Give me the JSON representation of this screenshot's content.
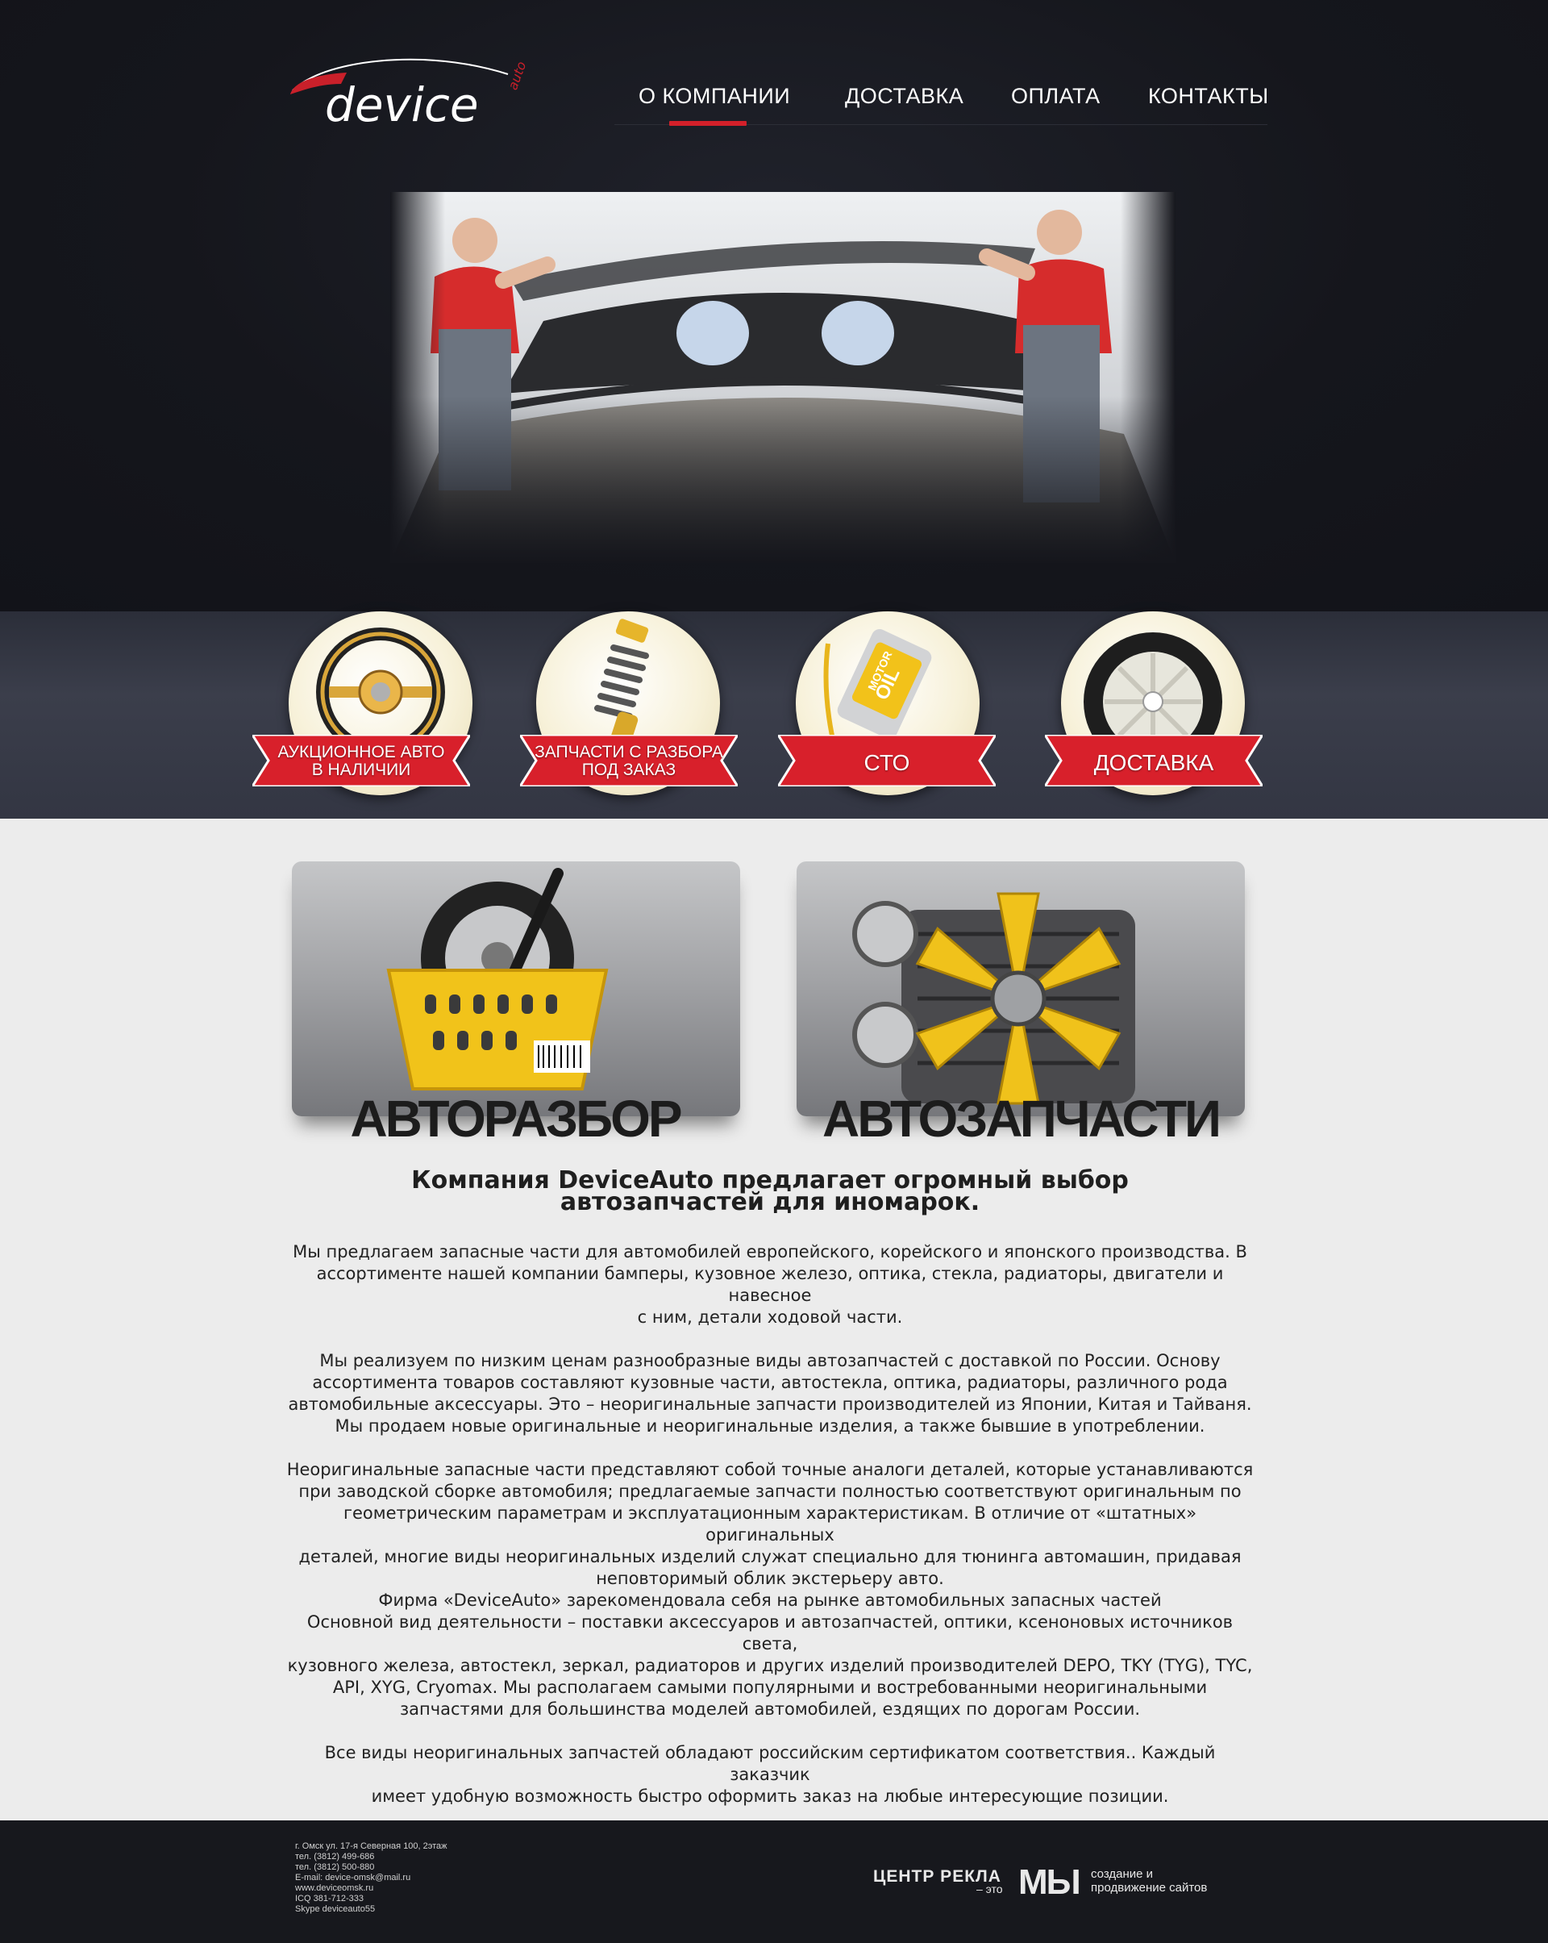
{
  "header": {
    "logo_text": "device",
    "logo_mark": "auto",
    "nav": [
      {
        "label": "О КОМПАНИИ",
        "active": true
      },
      {
        "label": "ДОСТАВКА"
      },
      {
        "label": "ОПЛАТА"
      },
      {
        "label": "КОНТАКТЫ"
      }
    ]
  },
  "hero": {
    "image": "mechanics-installing-windshield-photo"
  },
  "categories": [
    {
      "line1": "АУКЦИОННОЕ АВТО",
      "line2": "В НАЛИЧИИ",
      "icon": "steering-wheel-icon"
    },
    {
      "line1": "ЗАПЧАСТИ С РАЗБОРА",
      "line2": "ПОД ЗАКАЗ",
      "icon": "shock-absorber-icon"
    },
    {
      "line1": "СТО",
      "icon": "motor-oil-icon"
    },
    {
      "line1": "ДОСТАВКА",
      "icon": "wheel-icon"
    }
  ],
  "tiles": [
    {
      "title": "АВТОРАЗБОР",
      "icon": "basket-with-wheel-icon"
    },
    {
      "title": "АВТОЗАПЧАСТИ",
      "icon": "engine-fan-icon"
    }
  ],
  "oil_label": {
    "top": "MOTOR",
    "bottom": "OIL"
  },
  "content": {
    "headline_1": "Компания DeviceAuto предлагает огромный выбор",
    "headline_2": "автозапчастей для иномарок.",
    "p1": "Мы предлагаем запасные части для автомобилей европейского, корейского и японского производства. В\nассортименте нашей компании бамперы, кузовное железо, оптика, стекла, радиаторы, двигатели и навесное\nс ним, детали ходовой части.",
    "p2": "Мы реализуем по низким ценам разнообразные виды автозапчастей с доставкой по России. Основу\nассортимента товаров составляют кузовные части, автостекла, оптика, радиаторы, различного рода\nавтомобильные аксессуары. Это – неоригинальные запчасти производителей из Японии, Китая и Тайваня.\nМы продаем новые оригинальные и неоригинальные изделия, а также бывшие в употреблении.",
    "p3": "Неоригинальные запасные части представляют собой точные аналоги деталей, которые устанавливаются\nпри заводской сборке автомобиля; предлагаемые запчасти полностью соответствуют оригинальным по\nгеометрическим параметрам и эксплуатационным характеристикам. В отличие от «штатных» оригинальных\nдеталей, многие виды неоригинальных изделий служат специально для тюнинга автомашин, придавая\nнеповторимый облик экстерьеру авто.",
    "p4": "Фирма «DeviceAuto» зарекомендовала себя на рынке автомобильных запасных частей\nОсновной вид деятельности – поставки аксессуаров и автозапчастей, оптики, ксеноновых источников света,\nкузовного железа, автостекл, зеркал, радиаторов и других изделий производителей DEPO, TKY (TYG), TYC,\nAPI, XYG, Cryomax. Мы располагаем самыми популярными и востребованными неоригинальными\nзапчастями для большинства моделей автомобилей, ездящих по дорогам России.",
    "p5": "Все виды неоригинальных запчастей обладают российским сертификатом соответствия.. Каждый заказчик\nимеет удобную возможность быстро оформить заказ на любые интересующие позиции."
  },
  "footer": {
    "contacts": "г. Омск ул. 17-я Северная 100, 2этаж\nтел. (3812) 499-686\nтел. (3812) 500-880\nE-mail: device-omsk@mail.ru\nwww.deviceomsk.ru\nICQ 381-712-333\nSkype deviceauto55",
    "agency_part1": "ЦЕНТР  РЕКЛА",
    "agency_part2": "– это",
    "agency_part3": "МЫ",
    "agency_part4_line1": "создание и",
    "agency_part4_line2": "продвижение сайтов"
  },
  "colors": {
    "accent": "#d3202a",
    "header_bg": "#15161c",
    "band_bg": "#353845",
    "footer_bg": "#17181d",
    "gold": "#f2c21a"
  }
}
